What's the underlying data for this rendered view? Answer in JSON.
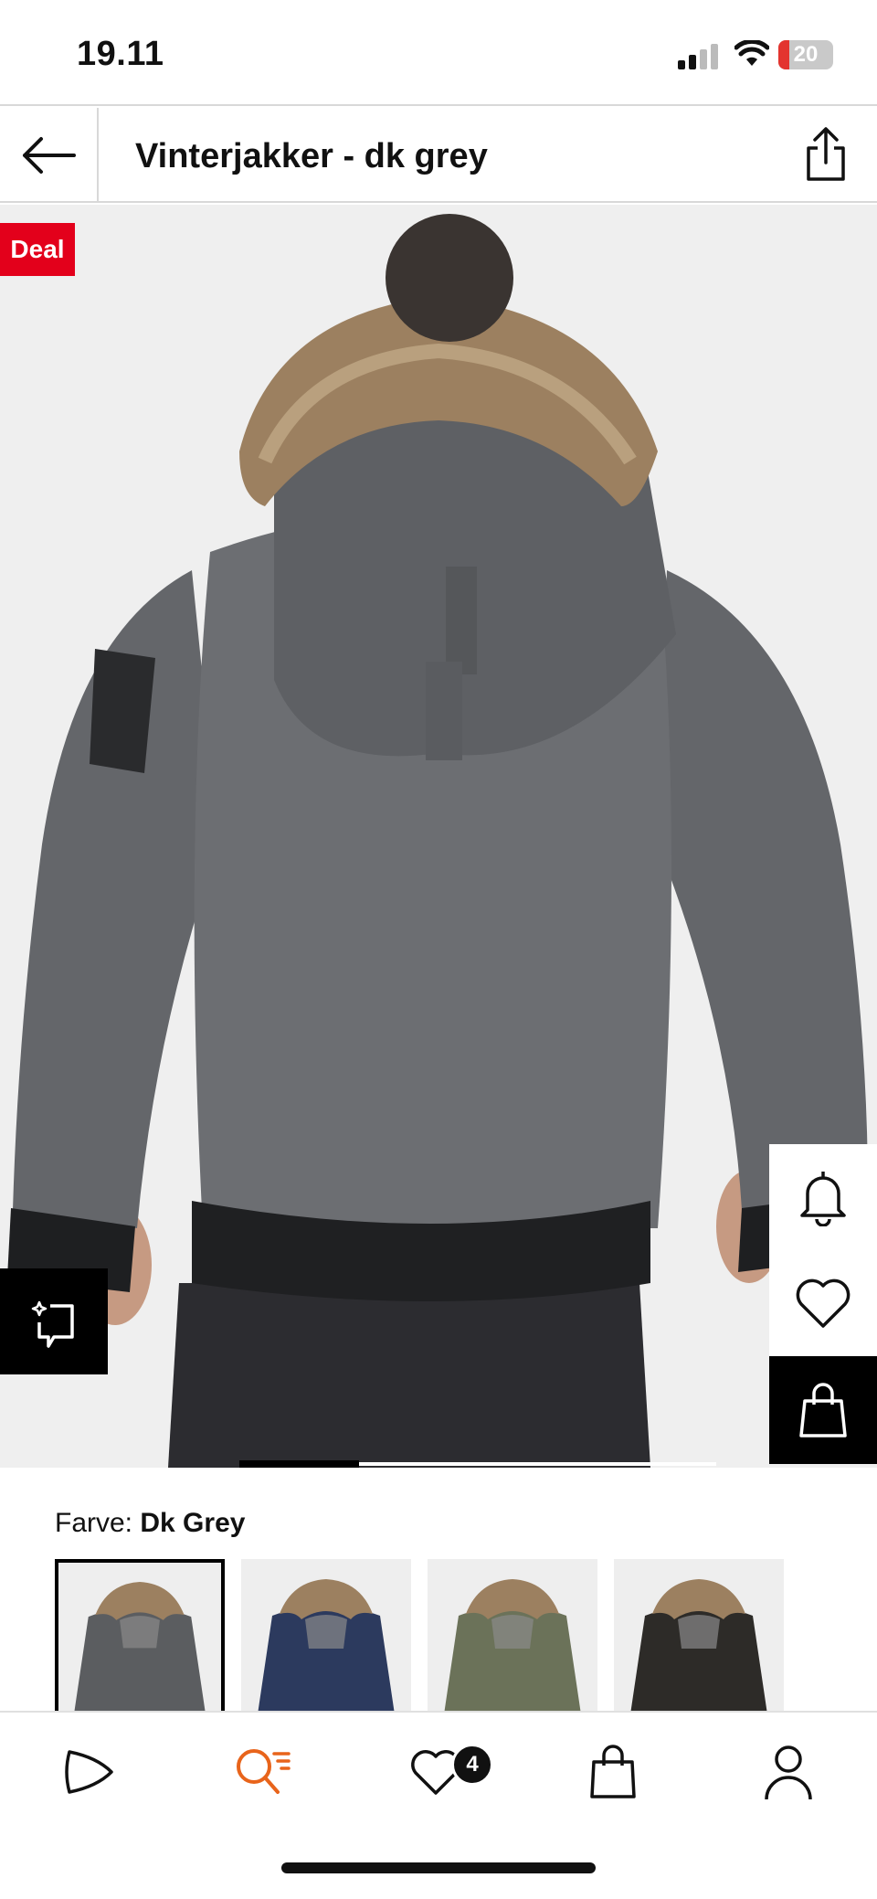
{
  "status_bar": {
    "time": "19.11",
    "battery_level": "20",
    "battery_fraction": 0.2
  },
  "header": {
    "title": "Vinterjakker - dk grey"
  },
  "product": {
    "badge": "Deal",
    "image_pager": {
      "current": 1,
      "total": 4
    }
  },
  "color": {
    "label": "Farve:",
    "selected": "Dk Grey",
    "swatches": [
      {
        "name": "dk-grey",
        "color": "#5b5d60"
      },
      {
        "name": "navy",
        "color": "#2c3a5e"
      },
      {
        "name": "olive",
        "color": "#6b7259"
      },
      {
        "name": "black",
        "color": "#2d2b28"
      }
    ]
  },
  "bottom_nav": {
    "favorites_count": "4",
    "active": "search",
    "active_color": "#e8641b"
  }
}
